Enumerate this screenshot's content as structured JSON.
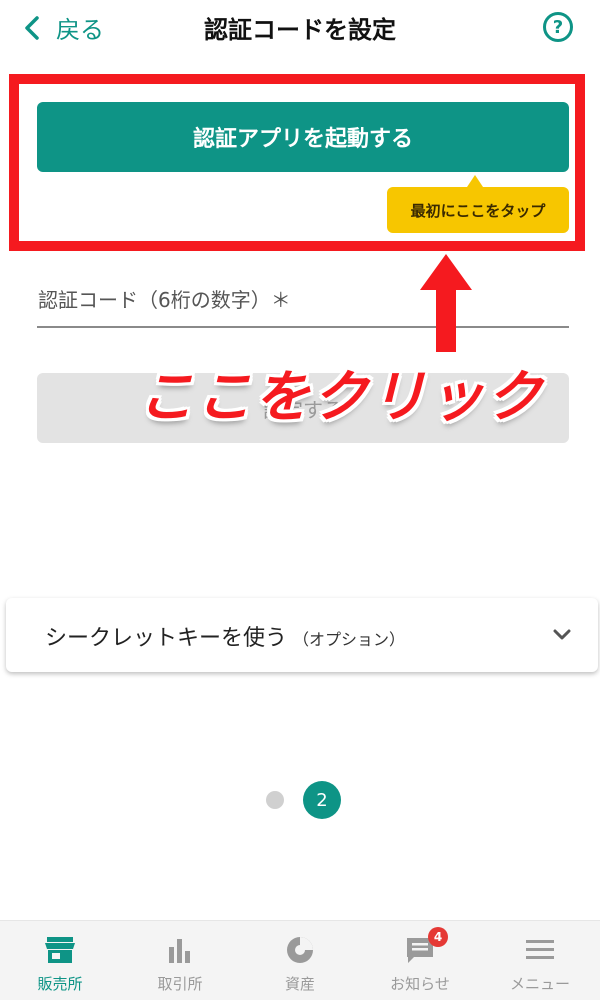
{
  "header": {
    "back_label": "戻る",
    "title": "認証コードを設定",
    "help_symbol": "?"
  },
  "launch_button": {
    "label": "認証アプリを起動する"
  },
  "tooltip": {
    "text": "最初にここをタップ"
  },
  "code_field": {
    "label": "認証コード（6桁の数字）＊"
  },
  "set_button": {
    "label": "設定する"
  },
  "annotation": {
    "text": "ここをクリック",
    "color": "#f51a1f"
  },
  "secret_key": {
    "label": "シークレットキーを使う",
    "sub": "（オプション）"
  },
  "pagination": {
    "current": "2"
  },
  "bottom_nav": {
    "items": [
      {
        "label": "販売所",
        "icon": "shop-icon"
      },
      {
        "label": "取引所",
        "icon": "bar-chart-icon"
      },
      {
        "label": "資産",
        "icon": "pie-chart-icon"
      },
      {
        "label": "お知らせ",
        "icon": "message-icon"
      },
      {
        "label": "メニュー",
        "icon": "menu-icon"
      }
    ],
    "notification_badge": "4"
  },
  "colors": {
    "accent": "#0e9486",
    "tooltip": "#f7c600",
    "annotation_red": "#f51a1f"
  }
}
